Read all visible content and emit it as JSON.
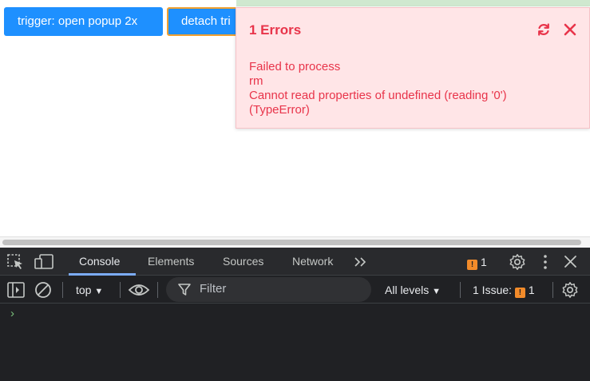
{
  "page": {
    "trigger_button": "trigger: open popup 2x",
    "detach_button": "detach tri"
  },
  "error_popup": {
    "title": "1 Errors",
    "lines": [
      "Failed to process",
      "rm",
      "Cannot read properties of undefined (reading '0')",
      "(TypeError)"
    ],
    "icons": [
      "refresh-icon",
      "close-icon"
    ]
  },
  "devtools": {
    "tabs": [
      "Console",
      "Elements",
      "Sources",
      "Network"
    ],
    "active_tab": "Console",
    "issues_badge_count": "1",
    "toolbar": {
      "context": "top",
      "filter_placeholder": "Filter",
      "levels": "All levels",
      "issues_label": "1 Issue:",
      "issues_count": "1"
    },
    "prompt": "›"
  },
  "colors": {
    "button_blue": "#1e90ff",
    "error_bg": "#ffe5e7",
    "error_text": "#e8344a",
    "devtools_bg": "#202124",
    "accent_blue": "#7cacf8",
    "warning_orange": "#f28b2a"
  }
}
